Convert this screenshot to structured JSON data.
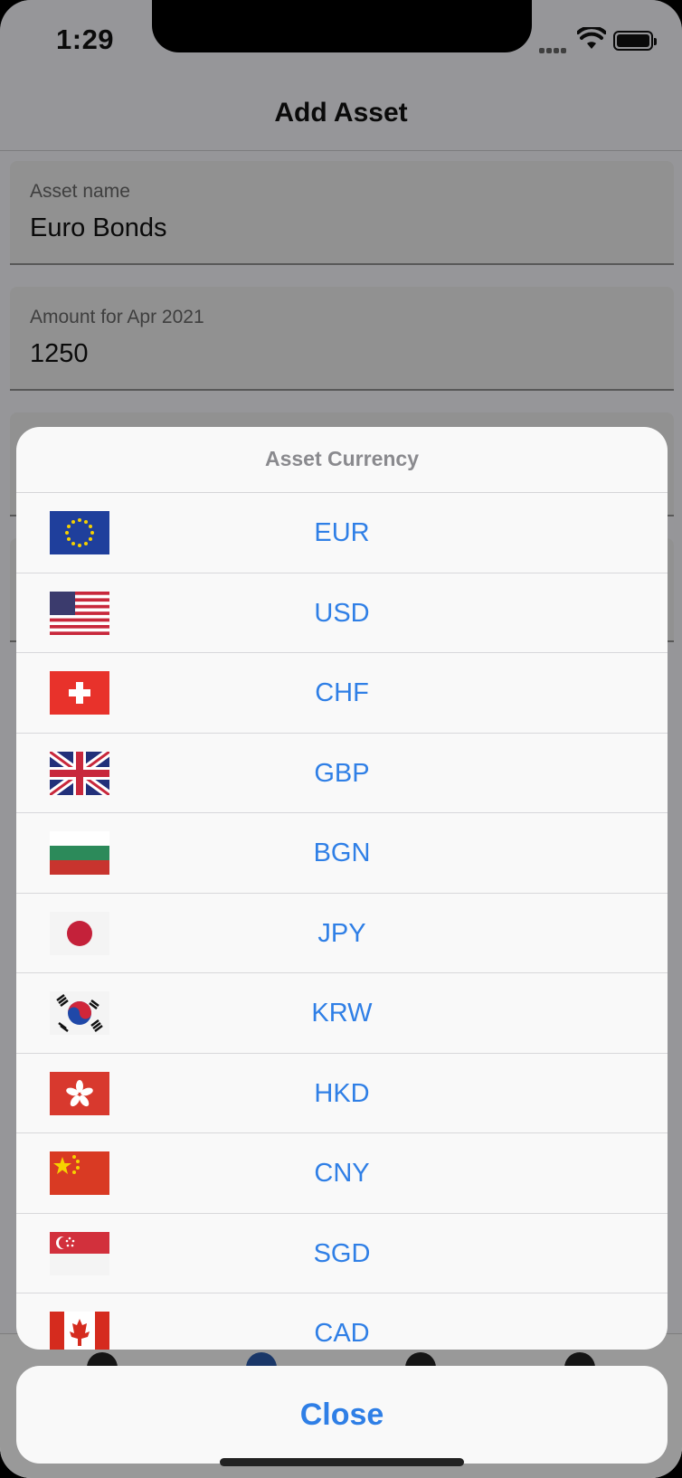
{
  "status": {
    "time": "1:29"
  },
  "nav": {
    "title": "Add Asset"
  },
  "form": {
    "asset_name": {
      "label": "Asset name",
      "value": "Euro Bonds"
    },
    "amount": {
      "label": "Amount for Apr 2021",
      "value": "1250"
    }
  },
  "sheet": {
    "title": "Asset Currency",
    "options": [
      {
        "code": "EUR",
        "flag": "eu-flag-icon"
      },
      {
        "code": "USD",
        "flag": "us-flag-icon"
      },
      {
        "code": "CHF",
        "flag": "ch-flag-icon"
      },
      {
        "code": "GBP",
        "flag": "gb-flag-icon"
      },
      {
        "code": "BGN",
        "flag": "bg-flag-icon"
      },
      {
        "code": "JPY",
        "flag": "jp-flag-icon"
      },
      {
        "code": "KRW",
        "flag": "kr-flag-icon"
      },
      {
        "code": "HKD",
        "flag": "hk-flag-icon"
      },
      {
        "code": "CNY",
        "flag": "cn-flag-icon"
      },
      {
        "code": "SGD",
        "flag": "sg-flag-icon"
      },
      {
        "code": "CAD",
        "flag": "ca-flag-icon"
      }
    ],
    "close_label": "Close"
  },
  "colors": {
    "accent": "#2f7fe6",
    "overlay": "rgba(0,0,0,0.38)"
  }
}
